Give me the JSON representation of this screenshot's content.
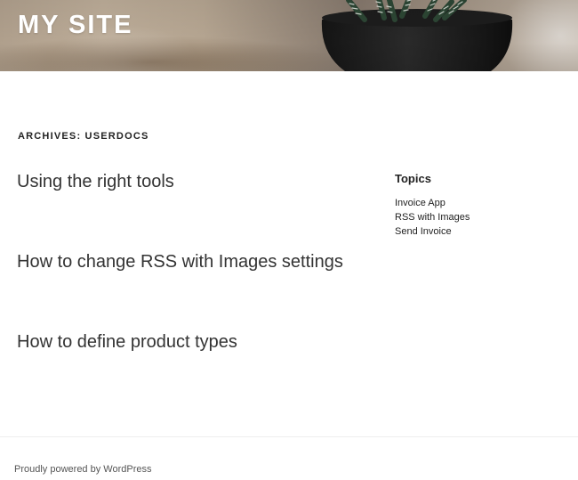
{
  "header": {
    "site_title": "MY SITE",
    "image_alt": "potted succulent plant header image"
  },
  "archive": {
    "heading": "ARCHIVES: USERDOCS"
  },
  "posts": [
    {
      "title": "Using the right tools"
    },
    {
      "title": "How to change RSS with Images settings"
    },
    {
      "title": "How to define product types"
    }
  ],
  "sidebar": {
    "widget_title": "Topics",
    "items": [
      {
        "label": "Invoice App"
      },
      {
        "label": "RSS with Images"
      },
      {
        "label": "Send Invoice"
      }
    ]
  },
  "footer": {
    "credit": "Proudly powered by WordPress"
  },
  "colors": {
    "text": "#222222",
    "header_title": "#ffffff",
    "footer_text": "#555555",
    "divider": "#eeeeee"
  }
}
